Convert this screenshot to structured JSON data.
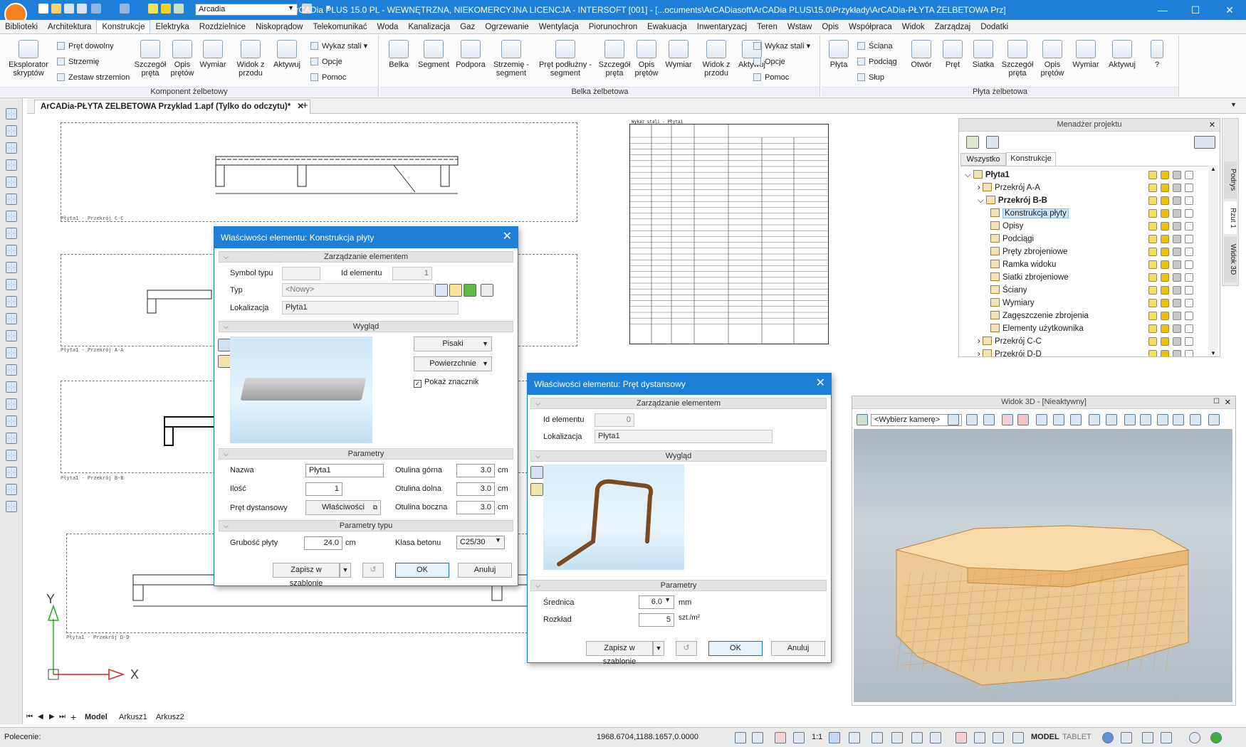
{
  "titlebar": {
    "font_combo": "Arcadia",
    "title": "ArCADia PLUS 15.0 PL - WEWNĘTRZNA, NIEKOMERCYJNA LICENCJA - INTERSOFT [001] - [...ocuments\\ArCADiasoft\\ArCADia PLUS\\15.0\\Przykłady\\ArCADia-PŁYTA ŻELBETOWA Prz]"
  },
  "menu": [
    "Biblioteki",
    "Architektura",
    "Konstrukcje",
    "Elektryka",
    "Rozdzielnice",
    "Niskoprądow",
    "Telekomunikać",
    "Woda",
    "Kanalizacja",
    "Gaz",
    "Ogrzewanie",
    "Wentylacja",
    "Piorunochron",
    "Ewakuacja",
    "Inwentaryzacj",
    "Teren",
    "Wstaw",
    "Opis",
    "Współpraca",
    "Widok",
    "Zarządzaj",
    "Dodatki"
  ],
  "menu_active": "Konstrukcje",
  "ribbon": {
    "groups": [
      {
        "title": "Komponent żelbetowy"
      },
      {
        "title": "Belka żelbetowa"
      },
      {
        "title": "Płyta żelbetowa"
      }
    ],
    "g1": {
      "eksplorator": "Eksplorator skryptów",
      "pret_dowolny": "Pręt dowolny",
      "strzemie": "Strzemię",
      "zestaw": "Zestaw strzemion",
      "szczegol": "Szczegół pręta",
      "opis": "Opis prętów",
      "wymiar": "Wymiar",
      "widok": "Widok z przodu",
      "aktywuj": "Aktywuj",
      "wykaz": "Wykaz stali",
      "opcje": "Opcje",
      "pomoc": "Pomoc"
    },
    "g2": {
      "belka": "Belka",
      "segment": "Segment",
      "podpora": "Podpora",
      "strzemie_seg": "Strzemię - segment",
      "pret_podluzny": "Pręt podłużny - segment",
      "szczegol": "Szczegół pręta",
      "opis": "Opis prętów",
      "wymiar": "Wymiar",
      "widok": "Widok z przodu",
      "aktywuj": "Aktywuj",
      "wykaz": "Wykaz stali",
      "opcje": "Opcje",
      "pomoc": "Pomoc"
    },
    "g3": {
      "plyta": "Płyta",
      "sciana": "Ściana",
      "podciag": "Podciąg",
      "slup": "Słup",
      "otwor": "Otwór",
      "pret": "Pręt",
      "siatka": "Siatka",
      "szczegol": "Szczegół pręta",
      "opis": "Opis prętów",
      "wymiar": "Wymiar",
      "aktywuj": "Aktywuj",
      "pomoc": "?"
    }
  },
  "doc_tab": "ArCADia-PŁYTA ZELBETOWA Przyklad 1.apf (Tylko do odczytu)*",
  "drawing": {
    "captions": [
      "Płyta1 - Przekrój C-C",
      "Płyta1 - Przekrój A-A",
      "Płyta1 - Przekrój B-B",
      "Płyta1 - Przekrój D-D"
    ],
    "table_title": "Wykaz stali - Płyta1",
    "table_rows": 32
  },
  "dialog1": {
    "title": "Właściwości elementu: Konstrukcja płyty",
    "sec_zarzadzanie": "Zarządzanie elementem",
    "symbol_typu_label": "Symbol typu",
    "id_label": "Id elementu",
    "id_value": "1",
    "typ_label": "Typ",
    "typ_value": "<Nowy>",
    "lokalizacja_label": "Lokalizacja",
    "lokalizacja_value": "Płyta1",
    "sec_wyglad": "Wygląd",
    "pisaki": "Pisaki",
    "powierzchnie": "Powierzchnie",
    "pokaz_znacznik": "Pokaż znacznik",
    "pokaz_checked": true,
    "sec_parametry": "Parametry",
    "nazwa_label": "Nazwa",
    "nazwa_value": "Płyta1",
    "ilosc_label": "Ilość",
    "ilosc_value": "1",
    "pret_label": "Pręt dystansowy",
    "wlasciwosci": "Właściwości",
    "otulina_gorna_label": "Otulina górna",
    "otulina_gorna_value": "3.0",
    "otulina_dolna_label": "Otulina dolna",
    "otulina_dolna_value": "3.0",
    "otulina_boczna_label": "Otulina boczna",
    "otulina_boczna_value": "3.0",
    "unit_cm": "cm",
    "sec_parametry_typu": "Parametry typu",
    "grubosc_label": "Grubość płyty",
    "grubosc_value": "24.0",
    "klasa_label": "Klasa betonu",
    "klasa_value": "C25/30",
    "zapisz": "Zapisz w szablonie",
    "ok": "OK",
    "anuluj": "Anuluj"
  },
  "dialog2": {
    "title": "Właściwości elementu: Pręt dystansowy",
    "sec_zarzadzanie": "Zarządzanie elementem",
    "id_label": "Id elementu",
    "id_value": "0",
    "lokalizacja_label": "Lokalizacja",
    "lokalizacja_value": "Płyta1",
    "sec_wyglad": "Wygląd",
    "sec_parametry": "Parametry",
    "srednica_label": "Średnica",
    "srednica_value": "6.0",
    "srednica_unit": "mm",
    "rozklad_label": "Rozkład",
    "rozklad_value": "5",
    "rozklad_unit": "szt./m²",
    "zapisz": "Zapisz w szablonie",
    "ok": "OK",
    "anuluj": "Anuluj"
  },
  "project_manager": {
    "title": "Menadżer projektu",
    "tabs": [
      "Wszystko",
      "Konstrukcje"
    ],
    "active_tab": "Konstrukcje",
    "tree": [
      {
        "label": "Płyta1",
        "level": 0,
        "bold": true
      },
      {
        "label": "Przekrój A-A",
        "level": 1
      },
      {
        "label": "Przekrój B-B",
        "level": 1,
        "bold": true
      },
      {
        "label": "Konstrukcja płyty",
        "level": 2,
        "selected": true
      },
      {
        "label": "Opisy",
        "level": 2
      },
      {
        "label": "Podciągi",
        "level": 2
      },
      {
        "label": "Pręty zbrojeniowe",
        "level": 2
      },
      {
        "label": "Ramka widoku",
        "level": 2
      },
      {
        "label": "Siatki zbrojeniowe",
        "level": 2
      },
      {
        "label": "Ściany",
        "level": 2
      },
      {
        "label": "Wymiary",
        "level": 2
      },
      {
        "label": "Zagęszczenie zbrojenia",
        "level": 2
      },
      {
        "label": "Elementy użytkownika",
        "level": 2
      },
      {
        "label": "Przekrój C-C",
        "level": 1
      },
      {
        "label": "Przekrój D-D",
        "level": 1
      }
    ]
  },
  "side_tabs": [
    "Podrys",
    "Rzut 1",
    "Widok 3D"
  ],
  "view3d": {
    "title": "Widok 3D - [Nieaktywny]",
    "camera": "<Wybierz kamerę>"
  },
  "axes": {
    "x": "X",
    "y": "Y"
  },
  "sheets": [
    "Model",
    "Arkusz1",
    "Arkusz2"
  ],
  "status": {
    "command_label": "Polecenie:",
    "coords": "1968.6704,1188.1657,0.0000",
    "scale": "1:1",
    "model": "MODEL",
    "tablet": "TABLET"
  },
  "colors": {
    "accent": "#1e7fd8",
    "slab": "#f3c98a"
  }
}
